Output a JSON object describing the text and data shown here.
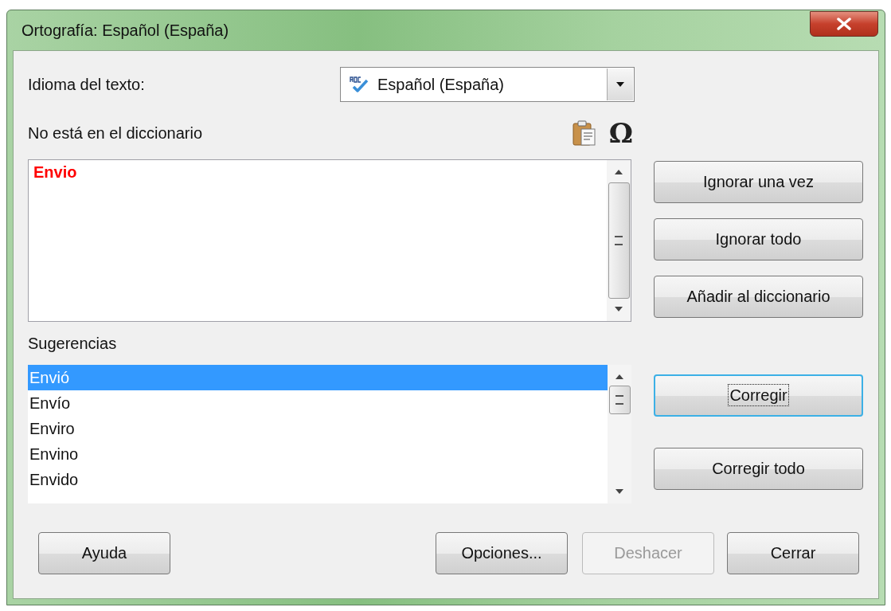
{
  "window": {
    "title": "Ortografía: Español (España)"
  },
  "language": {
    "label": "Idioma del texto:",
    "value": "Español (España)"
  },
  "not_in_dictionary": {
    "label": "No está en el diccionario",
    "text": "Envio",
    "special_character_glyph": "Ω"
  },
  "suggestions": {
    "label": "Sugerencias",
    "items": [
      {
        "text": "Envió",
        "selected": true
      },
      {
        "text": "Envío",
        "selected": false
      },
      {
        "text": "Enviro",
        "selected": false
      },
      {
        "text": "Envino",
        "selected": false
      },
      {
        "text": "Envido",
        "selected": false
      }
    ]
  },
  "side_buttons": [
    {
      "label": "Ignorar una vez",
      "focused": false
    },
    {
      "label": "Ignorar todo",
      "focused": false
    },
    {
      "label": "Añadir al diccionario",
      "focused": false
    },
    {
      "label": "Corregir",
      "focused": true
    },
    {
      "label": "Corregir todo",
      "focused": false
    }
  ],
  "bottom_buttons": [
    {
      "label": "Ayuda",
      "disabled": false
    },
    {
      "label": "Opciones...",
      "disabled": false
    },
    {
      "label": "Deshacer",
      "disabled": true
    },
    {
      "label": "Cerrar",
      "disabled": false
    }
  ]
}
